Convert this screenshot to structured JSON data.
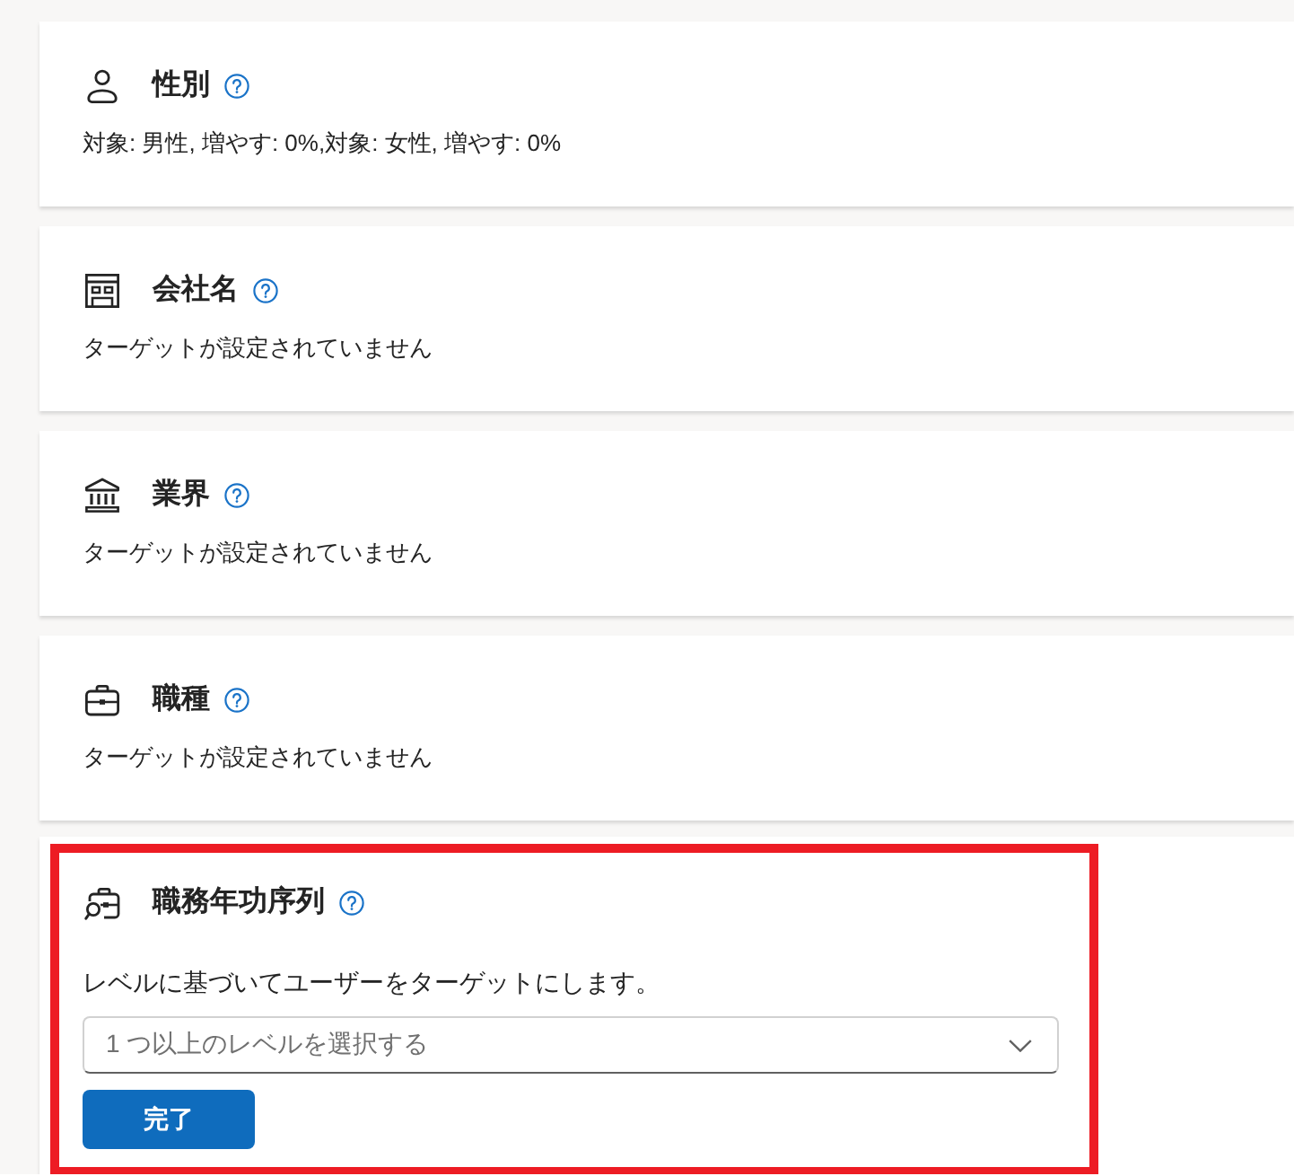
{
  "sections": [
    {
      "kind": "summary",
      "highlighted": false,
      "title": "性別",
      "summary": "対象: 男性, 増やす: 0%,対象: 女性, 増やす: 0%"
    },
    {
      "kind": "summary",
      "highlighted": false,
      "title": "会社名",
      "summary": "ターゲットが設定されていません"
    },
    {
      "kind": "summary",
      "highlighted": false,
      "title": "業界",
      "summary": "ターゲットが設定されていません"
    },
    {
      "kind": "summary",
      "highlighted": false,
      "title": "職種",
      "summary": "ターゲットが設定されていません"
    },
    {
      "kind": "editor",
      "highlighted": true,
      "title": "職務年功序列",
      "description": "レベルに基づいてユーザーをターゲットにします。",
      "dropdown": {
        "placeholder": "1 つ以上のレベルを選択する"
      },
      "button": "完了"
    }
  ]
}
